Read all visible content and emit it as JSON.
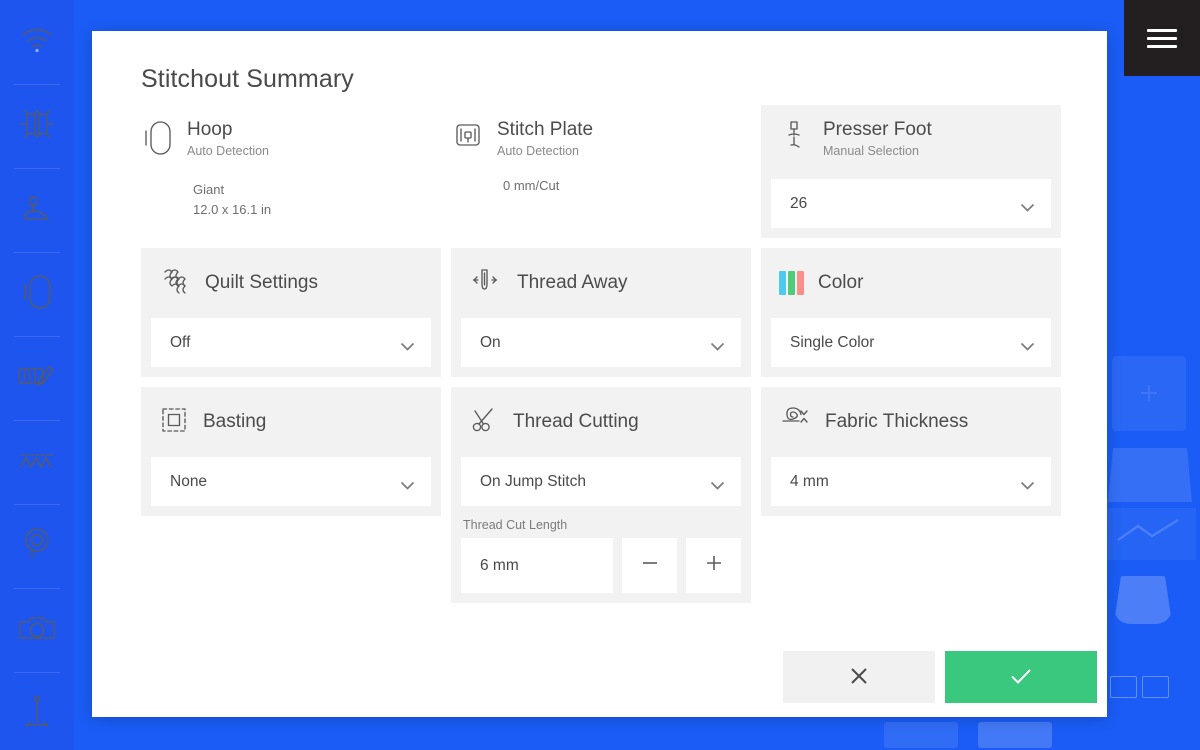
{
  "window": {
    "background_color": "#1a5cf5",
    "sidebar_color": "#1f55ef",
    "menu_button_color": "#231f20"
  },
  "sidebar": {
    "items": [
      {
        "icon": "wifi-icon"
      },
      {
        "icon": "bobbins-icon"
      },
      {
        "icon": "presser-foot-icon"
      },
      {
        "icon": "hoop-icon"
      },
      {
        "icon": "stitch-edit-icon"
      },
      {
        "icon": "zigzag-stitch-icon"
      },
      {
        "icon": "spool-icon"
      },
      {
        "icon": "camera-icon"
      },
      {
        "icon": "needle-icon"
      }
    ]
  },
  "menu": {
    "label": "menu-button",
    "icon": "hamburger-icon"
  },
  "modal": {
    "title": "Stitchout Summary",
    "summary": [
      {
        "id": "hoop",
        "icon": "hoop-icon",
        "title": "Hoop",
        "subtitle": "Auto Detection",
        "detail_line_1": "Giant",
        "detail_line_2": "12.0 x 16.1 in"
      },
      {
        "id": "stitch-plate",
        "icon": "stitch-plate-icon",
        "title": "Stitch Plate",
        "subtitle": "Auto Detection",
        "detail_line_1": "0 mm/Cut",
        "detail_line_2": ""
      }
    ],
    "presser_foot": {
      "id": "presser-foot",
      "icon": "presser-foot-icon",
      "title": "Presser Foot",
      "subtitle": "Manual Selection",
      "value": "26"
    },
    "settings": [
      {
        "id": "quilt-settings",
        "icon": "quilt-swirl-icon",
        "title": "Quilt Settings",
        "value": "Off"
      },
      {
        "id": "thread-away",
        "icon": "thread-away-icon",
        "title": "Thread Away",
        "value": "On"
      },
      {
        "id": "color",
        "icon": "color-swatches-icon",
        "title": "Color",
        "value": "Single Color"
      },
      {
        "id": "basting",
        "icon": "basting-icon",
        "title": "Basting",
        "value": "None"
      },
      {
        "id": "thread-cutting",
        "icon": "scissors-icon",
        "title": "Thread Cutting",
        "value": "On Jump Stitch"
      },
      {
        "id": "fabric-thickness",
        "icon": "fabric-spiral-icon",
        "title": "Fabric Thickness",
        "value": "4 mm"
      }
    ],
    "thread_cut_length": {
      "label": "Thread Cut Length",
      "value": "6 mm",
      "decrement_icon": "minus-icon",
      "increment_icon": "plus-icon"
    },
    "footer": {
      "cancel_icon": "close-icon",
      "confirm_icon": "check-icon",
      "confirm_color": "#3ac77e",
      "cancel_color": "#f1f1f2"
    }
  },
  "color_icon_swatches": [
    "#4ec9f0",
    "#4ecb7b",
    "#f98f8d"
  ]
}
